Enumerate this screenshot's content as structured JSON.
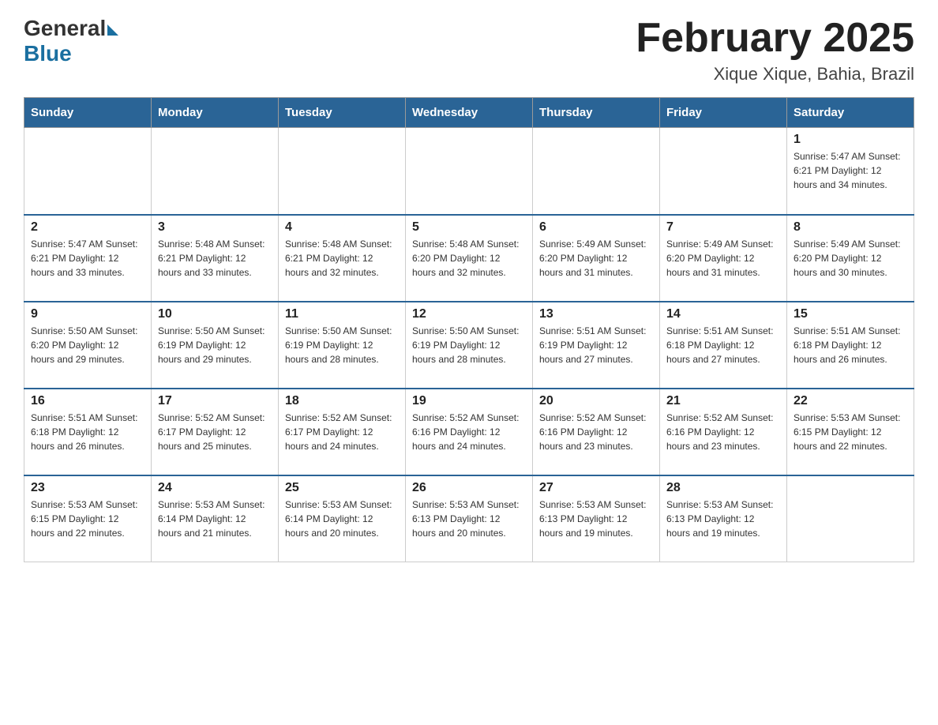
{
  "header": {
    "logo_general": "General",
    "logo_blue": "Blue",
    "month_title": "February 2025",
    "location": "Xique Xique, Bahia, Brazil"
  },
  "days_of_week": [
    "Sunday",
    "Monday",
    "Tuesday",
    "Wednesday",
    "Thursday",
    "Friday",
    "Saturday"
  ],
  "weeks": [
    [
      {
        "day": "",
        "info": ""
      },
      {
        "day": "",
        "info": ""
      },
      {
        "day": "",
        "info": ""
      },
      {
        "day": "",
        "info": ""
      },
      {
        "day": "",
        "info": ""
      },
      {
        "day": "",
        "info": ""
      },
      {
        "day": "1",
        "info": "Sunrise: 5:47 AM\nSunset: 6:21 PM\nDaylight: 12 hours and 34 minutes."
      }
    ],
    [
      {
        "day": "2",
        "info": "Sunrise: 5:47 AM\nSunset: 6:21 PM\nDaylight: 12 hours and 33 minutes."
      },
      {
        "day": "3",
        "info": "Sunrise: 5:48 AM\nSunset: 6:21 PM\nDaylight: 12 hours and 33 minutes."
      },
      {
        "day": "4",
        "info": "Sunrise: 5:48 AM\nSunset: 6:21 PM\nDaylight: 12 hours and 32 minutes."
      },
      {
        "day": "5",
        "info": "Sunrise: 5:48 AM\nSunset: 6:20 PM\nDaylight: 12 hours and 32 minutes."
      },
      {
        "day": "6",
        "info": "Sunrise: 5:49 AM\nSunset: 6:20 PM\nDaylight: 12 hours and 31 minutes."
      },
      {
        "day": "7",
        "info": "Sunrise: 5:49 AM\nSunset: 6:20 PM\nDaylight: 12 hours and 31 minutes."
      },
      {
        "day": "8",
        "info": "Sunrise: 5:49 AM\nSunset: 6:20 PM\nDaylight: 12 hours and 30 minutes."
      }
    ],
    [
      {
        "day": "9",
        "info": "Sunrise: 5:50 AM\nSunset: 6:20 PM\nDaylight: 12 hours and 29 minutes."
      },
      {
        "day": "10",
        "info": "Sunrise: 5:50 AM\nSunset: 6:19 PM\nDaylight: 12 hours and 29 minutes."
      },
      {
        "day": "11",
        "info": "Sunrise: 5:50 AM\nSunset: 6:19 PM\nDaylight: 12 hours and 28 minutes."
      },
      {
        "day": "12",
        "info": "Sunrise: 5:50 AM\nSunset: 6:19 PM\nDaylight: 12 hours and 28 minutes."
      },
      {
        "day": "13",
        "info": "Sunrise: 5:51 AM\nSunset: 6:19 PM\nDaylight: 12 hours and 27 minutes."
      },
      {
        "day": "14",
        "info": "Sunrise: 5:51 AM\nSunset: 6:18 PM\nDaylight: 12 hours and 27 minutes."
      },
      {
        "day": "15",
        "info": "Sunrise: 5:51 AM\nSunset: 6:18 PM\nDaylight: 12 hours and 26 minutes."
      }
    ],
    [
      {
        "day": "16",
        "info": "Sunrise: 5:51 AM\nSunset: 6:18 PM\nDaylight: 12 hours and 26 minutes."
      },
      {
        "day": "17",
        "info": "Sunrise: 5:52 AM\nSunset: 6:17 PM\nDaylight: 12 hours and 25 minutes."
      },
      {
        "day": "18",
        "info": "Sunrise: 5:52 AM\nSunset: 6:17 PM\nDaylight: 12 hours and 24 minutes."
      },
      {
        "day": "19",
        "info": "Sunrise: 5:52 AM\nSunset: 6:16 PM\nDaylight: 12 hours and 24 minutes."
      },
      {
        "day": "20",
        "info": "Sunrise: 5:52 AM\nSunset: 6:16 PM\nDaylight: 12 hours and 23 minutes."
      },
      {
        "day": "21",
        "info": "Sunrise: 5:52 AM\nSunset: 6:16 PM\nDaylight: 12 hours and 23 minutes."
      },
      {
        "day": "22",
        "info": "Sunrise: 5:53 AM\nSunset: 6:15 PM\nDaylight: 12 hours and 22 minutes."
      }
    ],
    [
      {
        "day": "23",
        "info": "Sunrise: 5:53 AM\nSunset: 6:15 PM\nDaylight: 12 hours and 22 minutes."
      },
      {
        "day": "24",
        "info": "Sunrise: 5:53 AM\nSunset: 6:14 PM\nDaylight: 12 hours and 21 minutes."
      },
      {
        "day": "25",
        "info": "Sunrise: 5:53 AM\nSunset: 6:14 PM\nDaylight: 12 hours and 20 minutes."
      },
      {
        "day": "26",
        "info": "Sunrise: 5:53 AM\nSunset: 6:13 PM\nDaylight: 12 hours and 20 minutes."
      },
      {
        "day": "27",
        "info": "Sunrise: 5:53 AM\nSunset: 6:13 PM\nDaylight: 12 hours and 19 minutes."
      },
      {
        "day": "28",
        "info": "Sunrise: 5:53 AM\nSunset: 6:13 PM\nDaylight: 12 hours and 19 minutes."
      },
      {
        "day": "",
        "info": ""
      }
    ]
  ]
}
